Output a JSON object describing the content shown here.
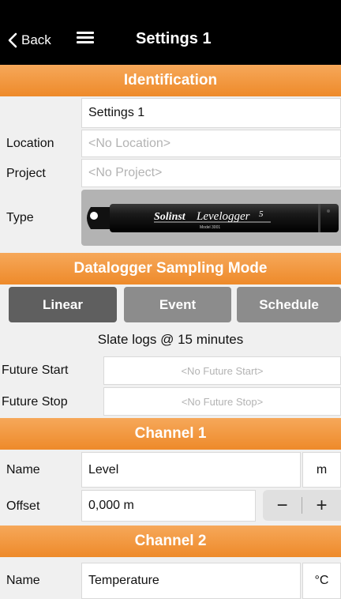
{
  "navbar": {
    "back_label": "Back",
    "title": "Settings 1"
  },
  "identification": {
    "header": "Identification",
    "name_value": "Settings 1",
    "location_label": "Location",
    "location_placeholder": "<No Location>",
    "project_label": "Project",
    "project_placeholder": "<No Project>",
    "type_label": "Type",
    "logger_brand": "Solinst",
    "logger_model": "Levelogger",
    "logger_version": "5",
    "logger_sub": "Model 3001"
  },
  "sampling": {
    "header": "Datalogger Sampling Mode",
    "modes": [
      {
        "label": "Linear",
        "active": true
      },
      {
        "label": "Event",
        "active": false
      },
      {
        "label": "Schedule",
        "active": false
      }
    ],
    "status": "Slate logs @ 15 minutes",
    "future_start_label": "Future Start",
    "future_start_placeholder": "<No Future Start>",
    "future_stop_label": "Future Stop",
    "future_stop_placeholder": "<No Future Stop>"
  },
  "channel1": {
    "header": "Channel 1",
    "name_label": "Name",
    "name_value": "Level",
    "unit": "m",
    "offset_label": "Offset",
    "offset_value": "0,000 m",
    "minus": "−",
    "plus": "+"
  },
  "channel2": {
    "header": "Channel 2",
    "name_label": "Name",
    "name_value": "Temperature",
    "unit": "°C"
  },
  "colors": {
    "accent": "#f0902f",
    "navbar": "#000000",
    "active_mode": "#5f5f5f",
    "inactive_mode": "#8c8c8c"
  },
  "icons": [
    "chevron-left-icon",
    "hamburger-menu-icon"
  ]
}
